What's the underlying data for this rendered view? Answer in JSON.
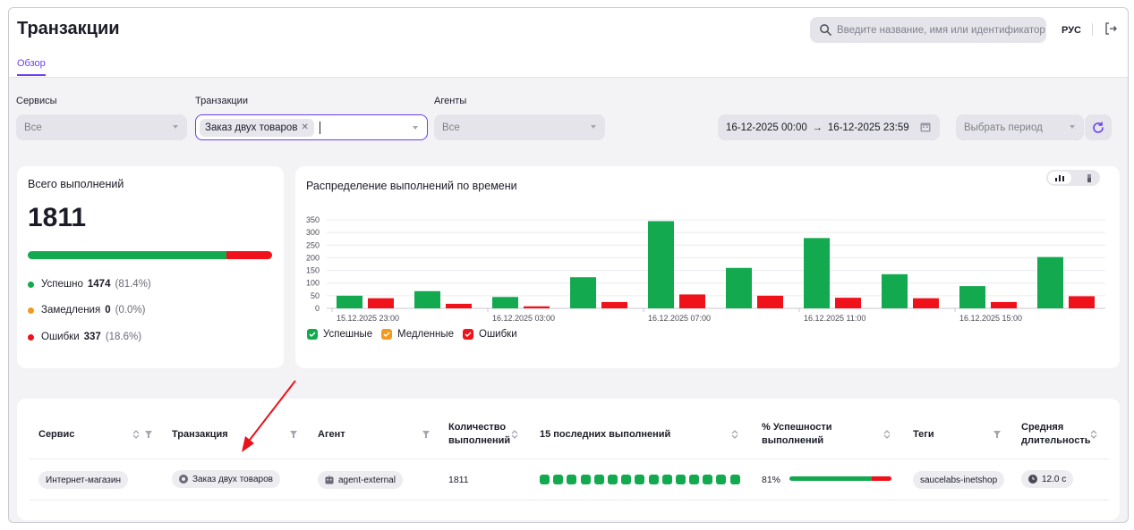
{
  "header": {
    "title": "Транзакции",
    "tab": "Обзор",
    "search_placeholder": "Введите название, имя или идентификатор",
    "language": "РУС"
  },
  "filters": {
    "services_label": "Сервисы",
    "services_value": "Все",
    "transactions_label": "Транзакции",
    "transactions_chip": "Заказ двух товаров",
    "agents_label": "Агенты",
    "agents_value": "Все",
    "date_from": "16-12-2025 00:00",
    "date_arrow": "→",
    "date_to": "16-12-2025 23:59",
    "period_placeholder": "Выбрать период"
  },
  "summary": {
    "title": "Всего выполнений",
    "total": "1811",
    "success_ratio": 0.814,
    "error_ratio": 0.186,
    "rows": [
      {
        "label": "Успешно",
        "count": "1474",
        "pct": "(81.4%)",
        "color": "#12a94f"
      },
      {
        "label": "Замедления",
        "count": "0",
        "pct": "(0.0%)",
        "color": "#f39a1e"
      },
      {
        "label": "Ошибки",
        "count": "337",
        "pct": "(18.6%)",
        "color": "#f0121b"
      }
    ]
  },
  "chart_data": {
    "type": "bar",
    "title": "Распределение выполнений по времени",
    "ylim": [
      0,
      350
    ],
    "yticks": [
      0,
      50,
      100,
      150,
      200,
      250,
      300,
      350
    ],
    "x_tick_labels": [
      "15.12.2025 23:00",
      "16.12.2025 03:00",
      "16.12.2025 07:00",
      "16.12.2025 11:00",
      "16.12.2025 15:00"
    ],
    "series": [
      {
        "name": "Успешные",
        "color": "#12a94f",
        "values": [
          50,
          68,
          45,
          123,
          345,
          160,
          278,
          135,
          88,
          203
        ]
      },
      {
        "name": "Медленные",
        "color": "#f39a1e",
        "values": [
          0,
          0,
          0,
          0,
          0,
          0,
          0,
          0,
          0,
          0
        ]
      },
      {
        "name": "Ошибки",
        "color": "#f0121b",
        "values": [
          40,
          18,
          8,
          25,
          55,
          50,
          42,
          40,
          25,
          48
        ]
      }
    ]
  },
  "table": {
    "headers": {
      "service": "Сервис",
      "transaction": "Транзакция",
      "agent": "Агент",
      "count_line1": "Количество",
      "count_line2": "выполнений",
      "last_runs": "15 последних выполнений",
      "success_line1": "% Успешности",
      "success_line2": "выполнений",
      "tags": "Теги",
      "duration_line1": "Средняя",
      "duration_line2": "длительность"
    },
    "row": {
      "service": "Интернет-магазин",
      "transaction": "Заказ двух товаров",
      "agent": "agent-external",
      "count": "1811",
      "last_runs_count": 15,
      "success_pct": "81%",
      "success_ratio": 0.81,
      "tag": "saucelabs-inetshop",
      "duration": "12.0 с"
    }
  },
  "colors": {
    "accent": "#6a3ff2",
    "success": "#12a94f",
    "slow": "#f39a1e",
    "error": "#f0121b",
    "annotation_arrow": "#e8141b"
  }
}
